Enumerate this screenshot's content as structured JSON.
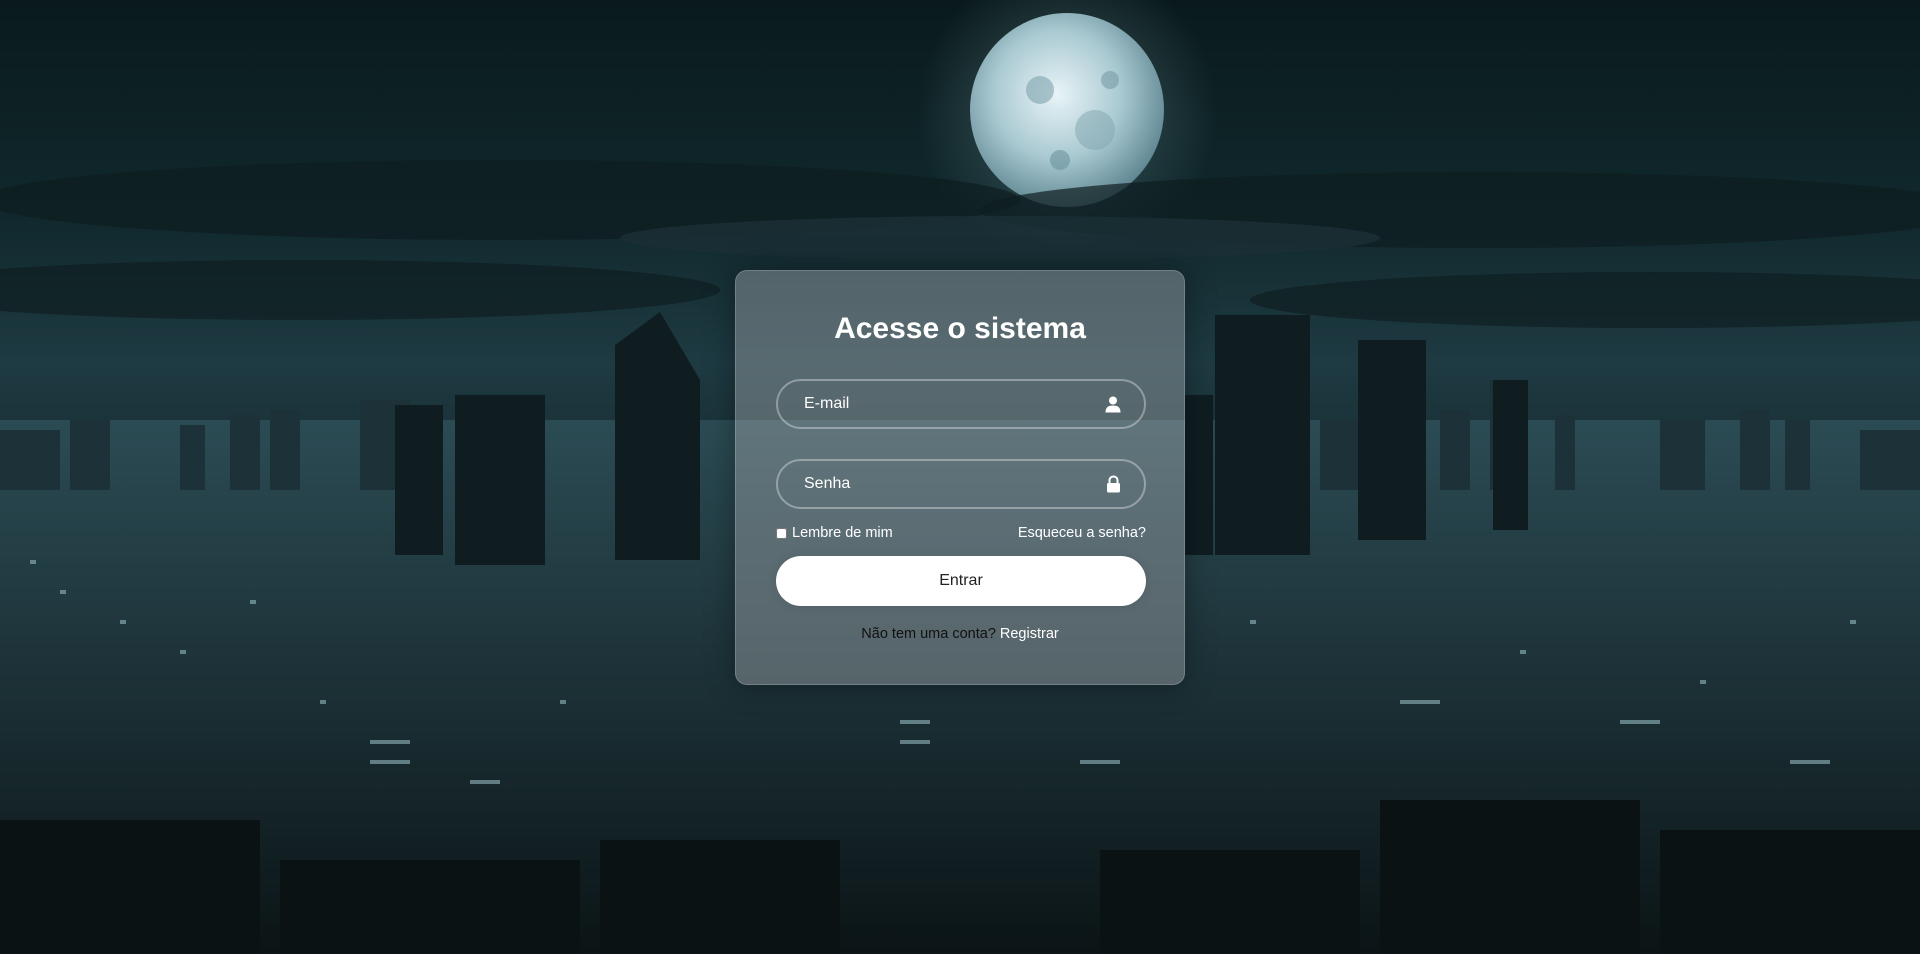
{
  "login": {
    "title": "Acesse o sistema",
    "email_placeholder": "E-mail",
    "password_placeholder": "Senha",
    "remember_label": "Lembre de mim",
    "forgot_label": "Esqueceu a senha?",
    "submit_label": "Entrar",
    "register_prompt": "Não tem uma conta?",
    "register_label": "Registrar"
  },
  "icons": {
    "email": "user-icon",
    "password": "lock-icon"
  },
  "colors": {
    "card_background": "#aaafb2",
    "button_background": "#ffffff",
    "button_text": "#222222",
    "sky_dark": "#0a1a1c",
    "moon": "#cfe4ea"
  }
}
